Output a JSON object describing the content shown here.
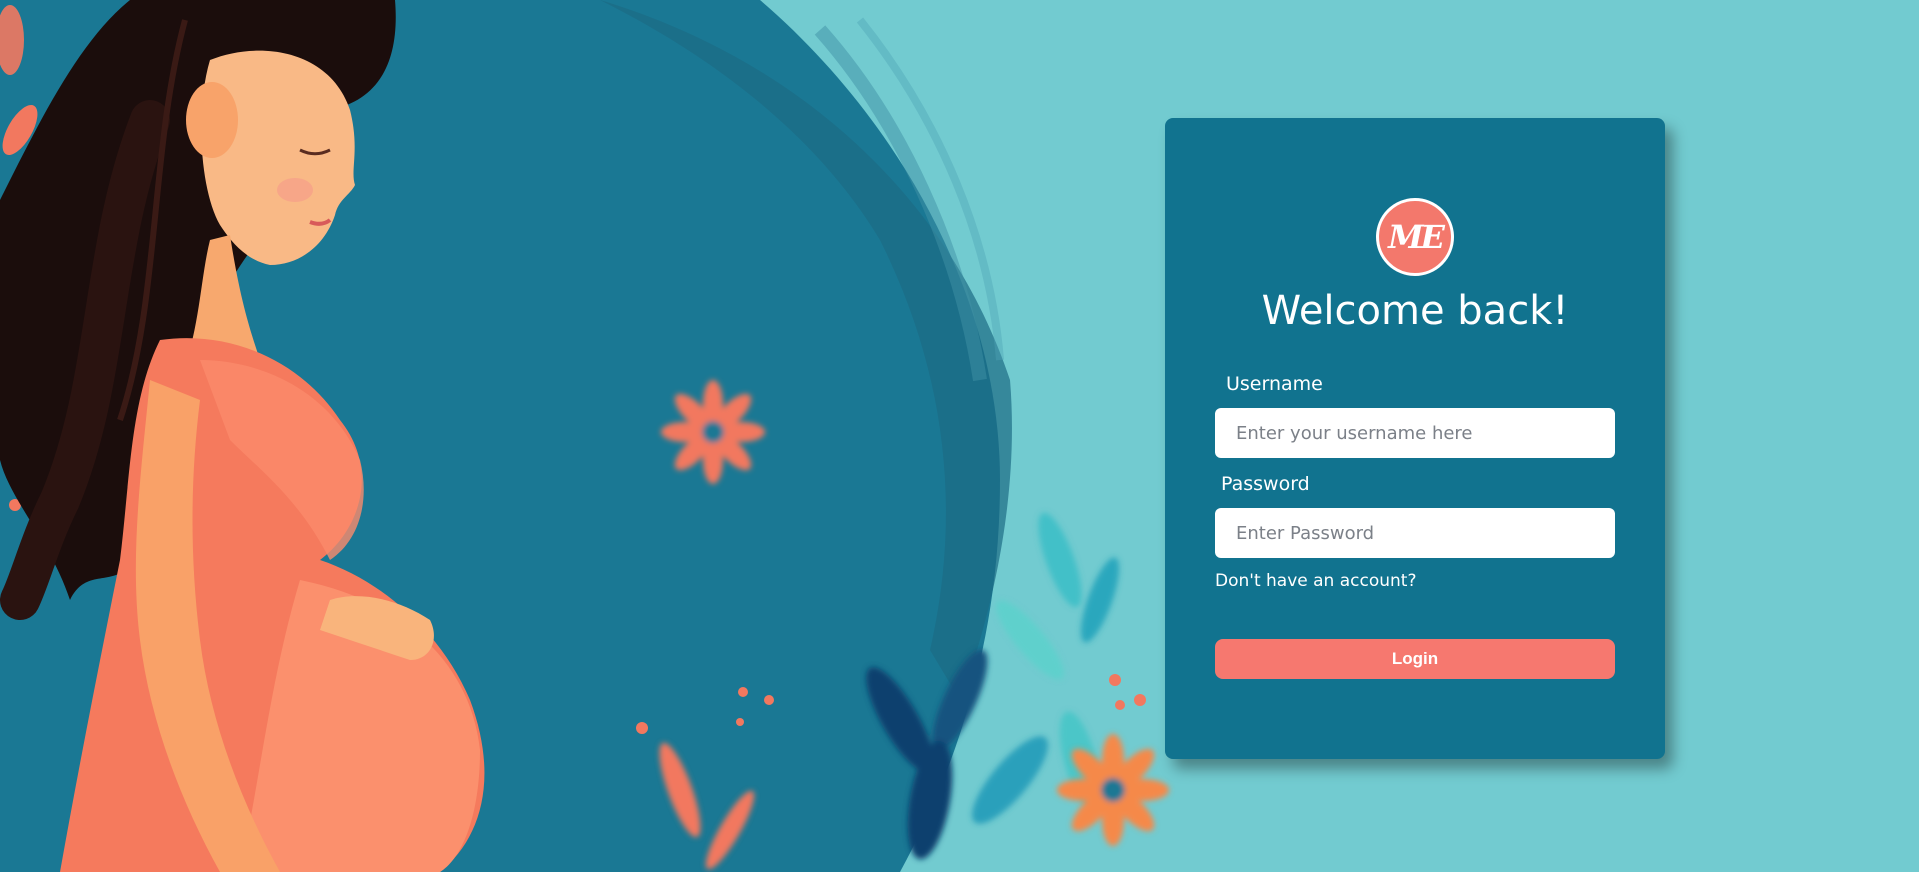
{
  "logo": {
    "text": "ME"
  },
  "login": {
    "title": "Welcome back!",
    "username_label": "Username",
    "username_placeholder": "Enter your username here",
    "username_value": "",
    "password_label": "Password",
    "password_placeholder": "Enter Password",
    "password_value": "",
    "signup_link": "Don't have an account?",
    "login_button": "Login"
  },
  "colors": {
    "page_background": "#72cbd0",
    "card_background": "#11738f",
    "accent": "#f6786f",
    "text": "#ffffff"
  },
  "background_image": {
    "icon": "pregnant-woman-illustration"
  }
}
